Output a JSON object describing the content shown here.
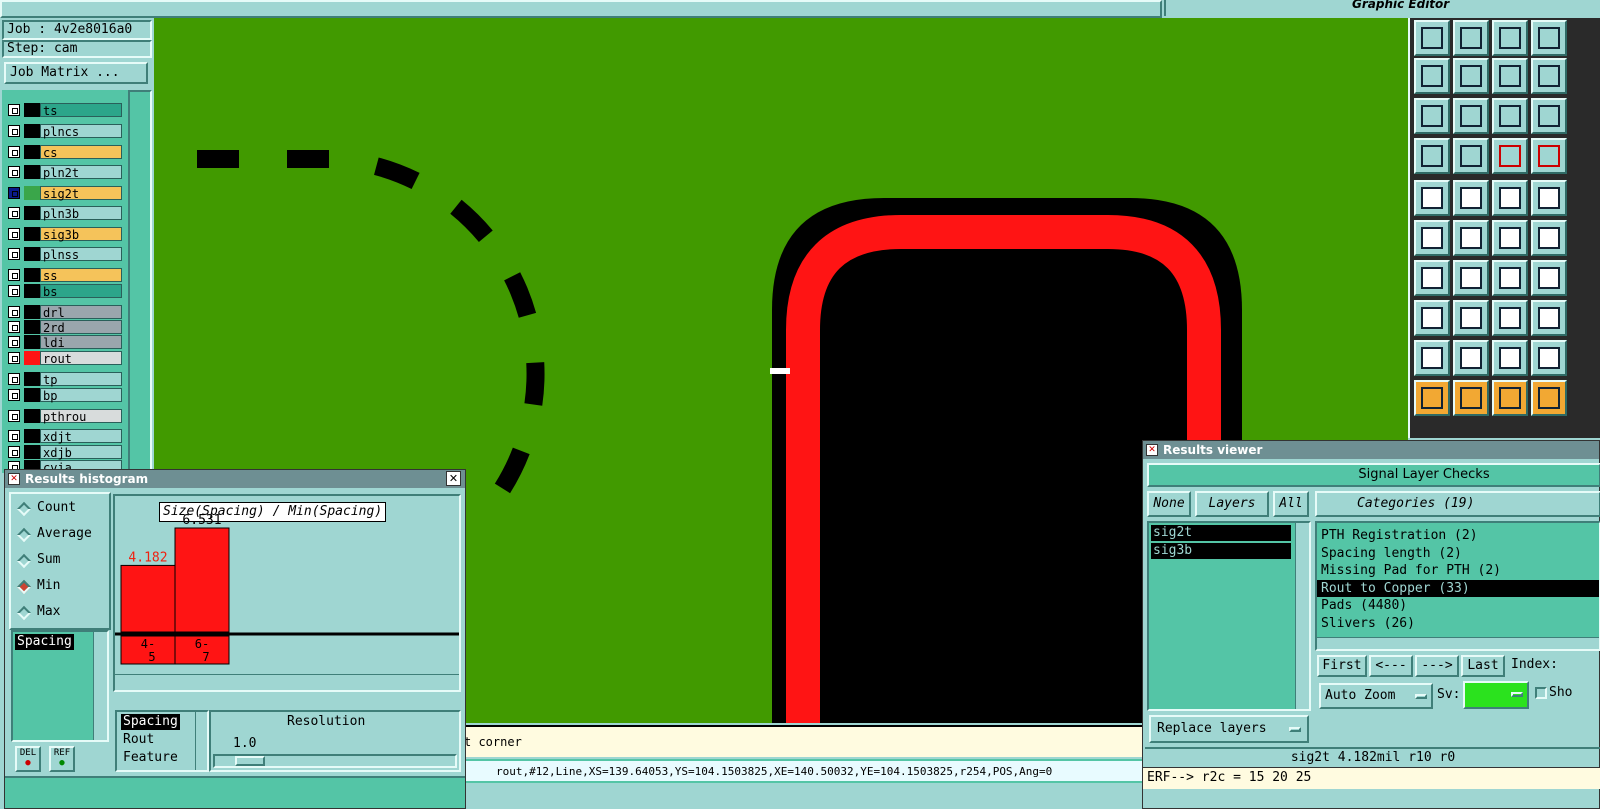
{
  "app": {
    "editor_label": "Graphic Editor"
  },
  "job_panel": {
    "job": "Job : 4v2e8016a0",
    "step": "Step: cam",
    "matrix_button": "Job Matrix ..."
  },
  "layers": [
    {
      "name": "ts",
      "color": "#2ca58a"
    },
    {
      "name": "plncs",
      "color": "#9fd6d2"
    },
    {
      "name": "cs",
      "color": "#f5c35a",
      "mark": "✍"
    },
    {
      "name": "pln2t",
      "color": "#9fd6d2"
    },
    {
      "name": "sig2t",
      "color": "#f5c35a",
      "mark": "✍⊞"
    },
    {
      "name": "pln3b",
      "color": "#9fd6d2"
    },
    {
      "name": "sig3b",
      "color": "#f5c35a",
      "mark": "✍"
    },
    {
      "name": "plnss",
      "color": "#9fd6d2"
    },
    {
      "name": "ss",
      "color": "#f5c35a"
    },
    {
      "name": "bs",
      "color": "#2ca58a",
      "mark": "✍"
    },
    {
      "name": "drl",
      "color": "#9aa6ad"
    },
    {
      "name": "2rd",
      "color": "#9aa6ad"
    },
    {
      "name": "ldi",
      "color": "#9aa6ad"
    },
    {
      "name": "rout",
      "color": "#d8dcdc"
    },
    {
      "name": "tp",
      "color": "#9fd6d2"
    },
    {
      "name": "bp",
      "color": "#9fd6d2"
    },
    {
      "name": "pthrou",
      "color": "#d8dcdc"
    },
    {
      "name": "xdjt",
      "color": "#9fd6d2"
    },
    {
      "name": "xdjb",
      "color": "#9fd6d2"
    },
    {
      "name": "cvia",
      "color": "#9fd6d2"
    }
  ],
  "histogram": {
    "title": "Results histogram",
    "modes": [
      "Count",
      "Average",
      "Sum",
      "Min",
      "Max"
    ],
    "selected_mode": "Min",
    "chart_title": "Size(Spacing) / Min(Spacing)",
    "bars": [
      {
        "label": "4.182",
        "value": 4.182,
        "bin": "4-\n5"
      },
      {
        "label": "6.531",
        "value": 6.531,
        "bin": "6-\n7"
      }
    ],
    "list_item": "Spacing",
    "bottom_list": [
      "Spacing",
      "Rout",
      "Feature"
    ],
    "resolution_label": "Resolution",
    "resolution_value": "1.0",
    "del_label": "DEL",
    "ref_label": "REF"
  },
  "message_bar": {
    "text": "t corner"
  },
  "status_bar": {
    "text": "rout,#12,Line,XS=139.64053,YS=104.1503825,XE=140.50032,YE=104.1503825,r254,POS,Ang=0"
  },
  "results_viewer": {
    "title": "Results viewer",
    "header": "Signal Layer Checks",
    "none_button": "None",
    "layers_label": "Layers",
    "all_button": "All",
    "layers": [
      "sig2t",
      "sig3b"
    ],
    "categories_label": "Categories (19)",
    "categories": [
      "PTH Registration (2)",
      "Spacing length (2)",
      "Missing Pad for PTH (2)",
      "Rout to Copper (33)",
      "Pads (4480)",
      "Slivers (26)"
    ],
    "selected_category": "Rout to Copper (33)",
    "nav": {
      "first": "First",
      "prev": "<---",
      "next": "--->",
      "last": "Last",
      "index": "Index:"
    },
    "auto_zoom": "Auto Zoom",
    "sv_label": "Sv:",
    "show_label": "Sho",
    "replace_layers": "Replace layers",
    "result_info": "sig2t 4.182mil  r10  r0"
  },
  "command_line": {
    "text": "ERF--> r2c = 15 20 25"
  },
  "colors": {
    "canvas": "#419a00",
    "feature": "#000000",
    "rout": "#ff1414",
    "panel": "#9fd6d2",
    "accent": "#54c5a6"
  }
}
